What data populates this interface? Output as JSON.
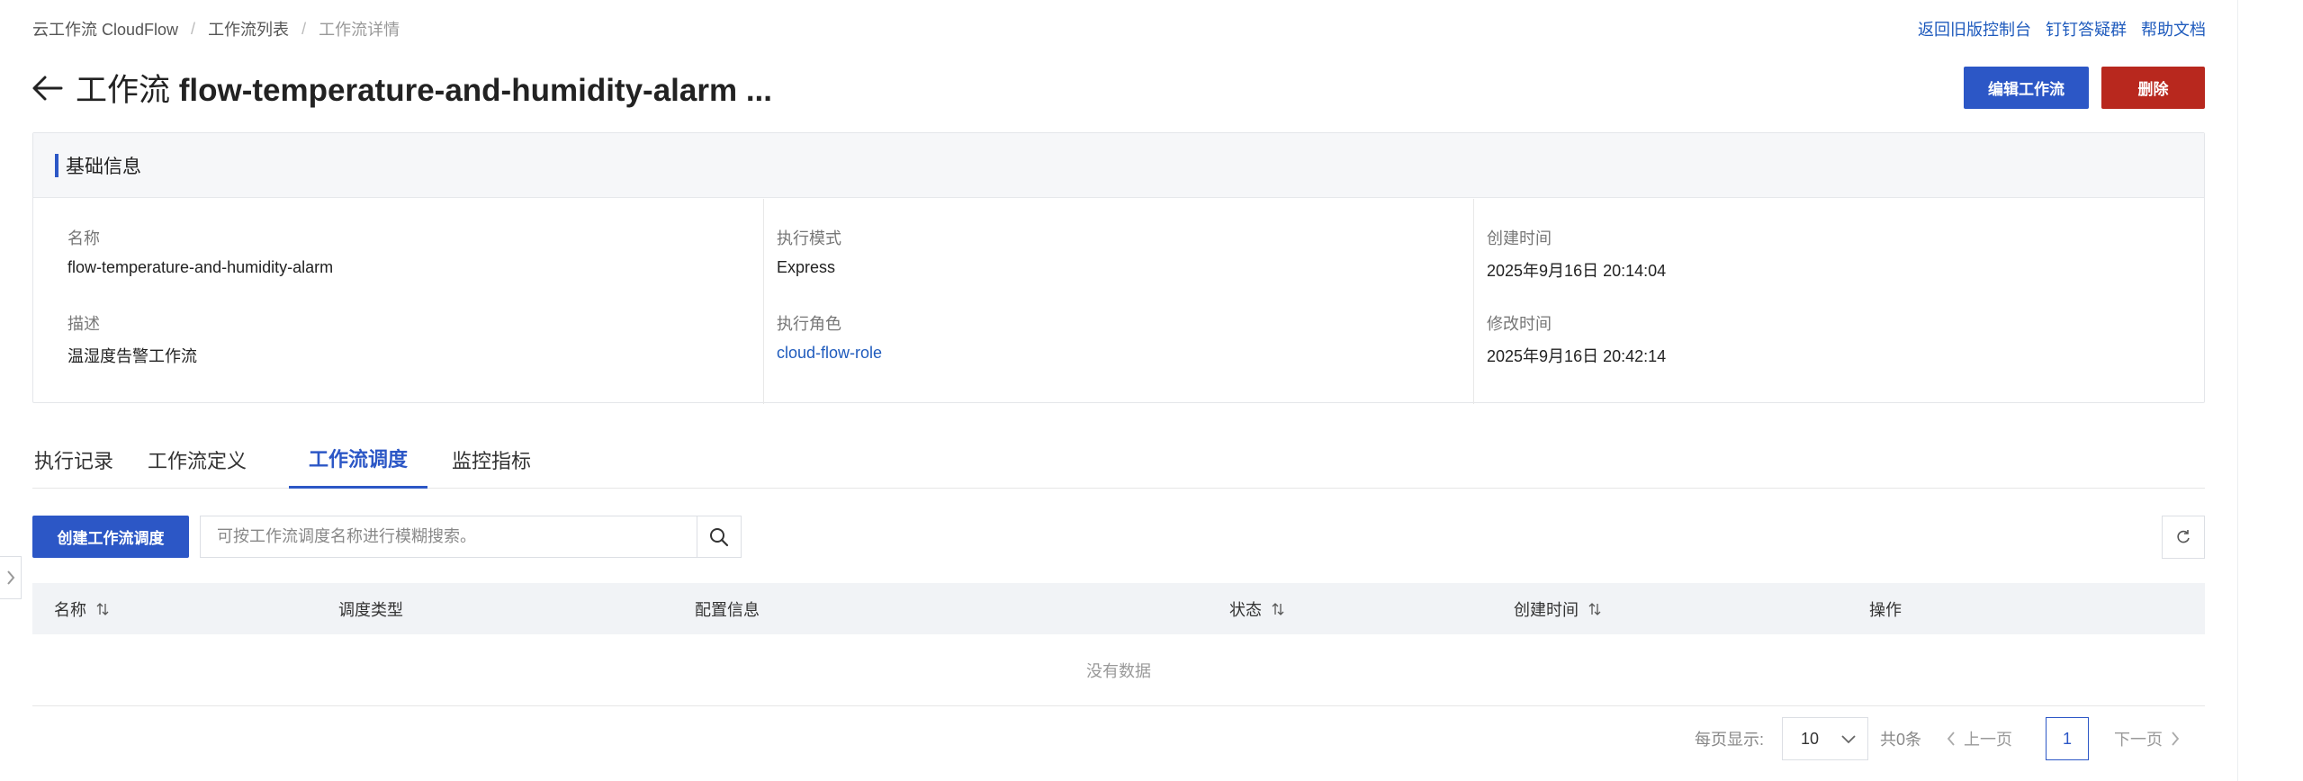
{
  "breadcrumb": {
    "items": [
      "云工作流 CloudFlow",
      "工作流列表"
    ],
    "current": "工作流详情",
    "separator": "/"
  },
  "top_links": [
    "返回旧版控制台",
    "钉钉答疑群",
    "帮助文档"
  ],
  "title": {
    "prefix": "工作流",
    "name": "flow-temperature-and-humidity-alarm ..."
  },
  "actions": {
    "edit_label": "编辑工作流",
    "delete_label": "删除"
  },
  "basic_info": {
    "header": "基础信息",
    "fields": [
      {
        "label": "名称",
        "value": "flow-temperature-and-humidity-alarm"
      },
      {
        "label": "执行模式",
        "value": "Express"
      },
      {
        "label": "创建时间",
        "value": "2025年9月16日 20:14:04"
      },
      {
        "label": "描述",
        "value": "温湿度告警工作流"
      },
      {
        "label": "执行角色",
        "value": "cloud-flow-role"
      },
      {
        "label": "修改时间",
        "value": "2025年9月16日 20:42:14"
      }
    ]
  },
  "tabs": [
    {
      "label": "执行记录"
    },
    {
      "label": "工作流定义"
    },
    {
      "label": "工作流调度"
    },
    {
      "label": "监控指标"
    }
  ],
  "active_tab": "工作流调度",
  "toolbar": {
    "create_label": "创建工作流调度",
    "search_placeholder": "可按工作流调度名称进行模糊搜索。"
  },
  "table": {
    "columns": [
      {
        "label": "名称",
        "sortable": true
      },
      {
        "label": "调度类型",
        "sortable": false
      },
      {
        "label": "配置信息",
        "sortable": false
      },
      {
        "label": "状态",
        "sortable": true
      },
      {
        "label": "创建时间",
        "sortable": true
      },
      {
        "label": "操作",
        "sortable": false
      }
    ],
    "empty_text": "没有数据"
  },
  "pagination": {
    "page_size_label": "每页显示:",
    "page_size": "10",
    "total": "共0条",
    "prev": "上一页",
    "current_page": "1",
    "next": "下一页"
  },
  "colors": {
    "primary": "#2c57c6",
    "danger": "#b8281e",
    "link": "#1f5bbd"
  }
}
